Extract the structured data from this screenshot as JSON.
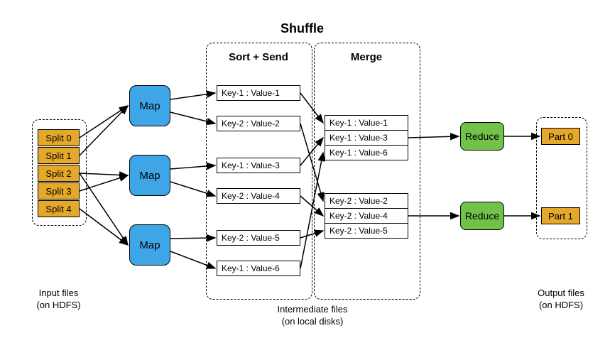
{
  "titles": {
    "shuffle": "Shuffle",
    "sort_send": "Sort + Send",
    "merge": "Merge"
  },
  "captions": {
    "input": "Input files\n(on HDFS)",
    "intermediate": "Intermediate files\n(on local disks)",
    "output": "Output files\n(on HDFS)"
  },
  "splits": [
    "Split 0",
    "Split 1",
    "Split 2",
    "Split 3",
    "Split 4"
  ],
  "maps": [
    "Map",
    "Map",
    "Map"
  ],
  "kv_sort": [
    "Key-1 : Value-1",
    "Key-2 : Value-2",
    "Key-1 : Value-3",
    "Key-2 : Value-4",
    "Key-2 : Value-5",
    "Key-1 : Value-6"
  ],
  "kv_merge_group1": [
    "Key-1 : Value-1",
    "Key-1 : Value-3",
    "Key-1 : Value-6"
  ],
  "kv_merge_group2": [
    "Key-2 : Value-2",
    "Key-2 : Value-4",
    "Key-2 : Value-5"
  ],
  "reduces": [
    "Reduce",
    "Reduce"
  ],
  "parts": [
    "Part 0",
    "Part 1"
  ]
}
